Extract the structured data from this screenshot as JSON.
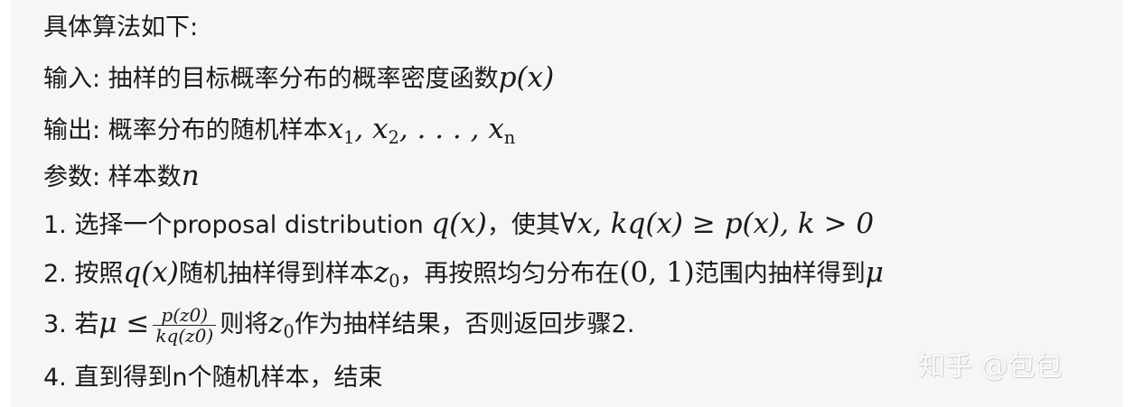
{
  "lines": {
    "l0": "具体算法如下:",
    "l1_label": "输入: 抽样的目标概率分布的概率密度函数",
    "l1_math": "p(x)",
    "l2_label": "输出: 概率分布的随机样本",
    "l2_math_a": "x",
    "l2_sub_1": "1",
    "l2_math_b": ", x",
    "l2_sub_2": "2",
    "l2_math_c": ", . . . , x",
    "l2_sub_n": "n",
    "l3_label": "参数: 样本数",
    "l3_math": "n",
    "l4_prefix": "1. 选择一个proposal distribution ",
    "l4_math_a": "q(x)",
    "l4_mid": "，使其",
    "l4_math_b": "∀x, kq(x) ≥ p(x), k > 0",
    "l5_prefix": "2. 按照",
    "l5_math_a": "q(x)",
    "l5_mid1": "随机抽样得到样本",
    "l5_math_z": "z",
    "l5_sub": "0",
    "l5_mid2": "，再按照均匀分布在",
    "l5_math_b": "(0, 1)",
    "l5_mid3": "范围内抽样得到",
    "l5_math_mu": "μ",
    "l6_prefix": "3. 若",
    "l6_math": "μ ≤",
    "l6_num": "p(z0)",
    "l6_den": "kq(z0)",
    "l6_mid": "则将",
    "l6_math_z": "z",
    "l6_sub": "0",
    "l6_suffix": "作为抽样结果，否则返回步骤2.",
    "l7": "4. 直到得到n个随机样本，结束"
  },
  "watermark": "知乎 @包包",
  "colors": {
    "background": "#f6f6f6",
    "text": "#1a1a1a"
  }
}
